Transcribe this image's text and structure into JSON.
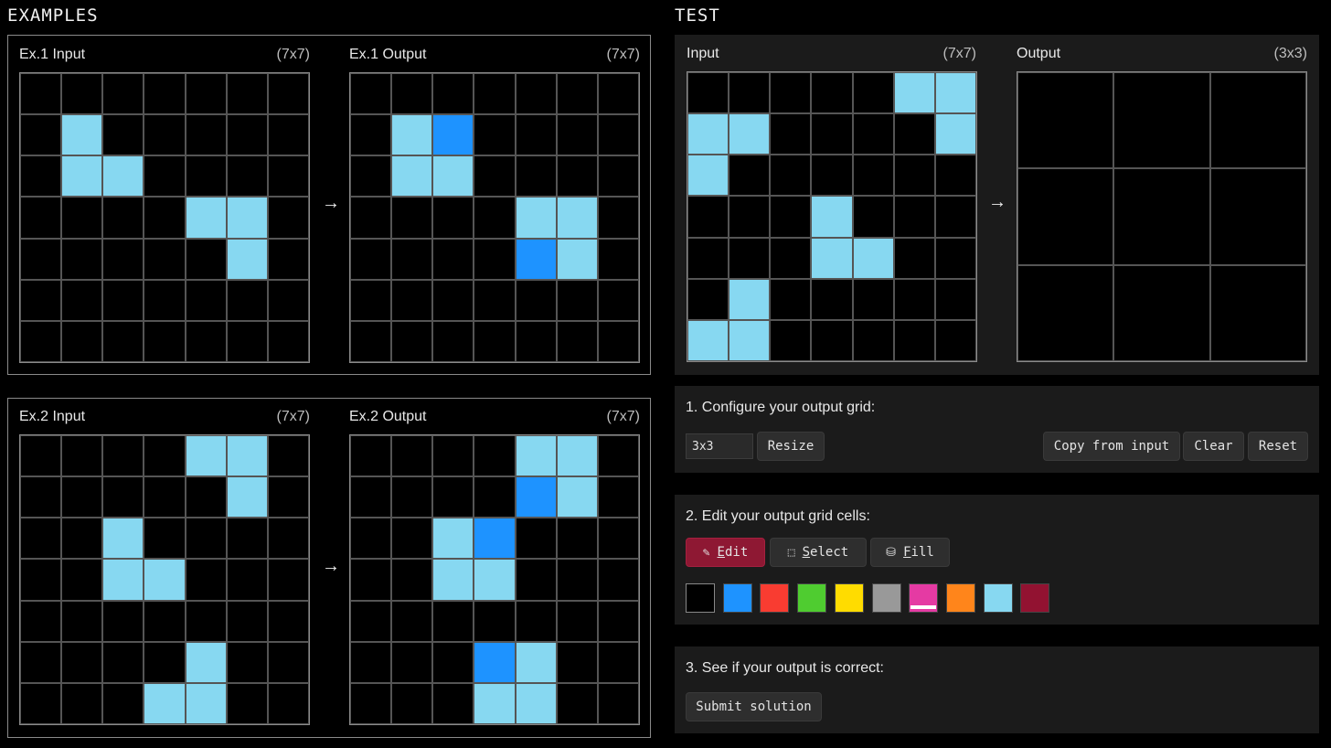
{
  "examples_title": "EXAMPLES",
  "test_title": "TEST",
  "palette": [
    "#000000",
    "#1e93ff",
    "#f93c31",
    "#4fcc30",
    "#ffdc00",
    "#999999",
    "#e53aa3",
    "#ff851b",
    "#87d8f1",
    "#921231"
  ],
  "examples": [
    {
      "input_label": "Ex.1 Input",
      "input_size": "(7x7)",
      "output_label": "Ex.1 Output",
      "output_size": "(7x7)",
      "arrow": "→",
      "input": [
        [
          0,
          0,
          0,
          0,
          0,
          0,
          0
        ],
        [
          0,
          8,
          0,
          0,
          0,
          0,
          0
        ],
        [
          0,
          8,
          8,
          0,
          0,
          0,
          0
        ],
        [
          0,
          0,
          0,
          0,
          8,
          8,
          0
        ],
        [
          0,
          0,
          0,
          0,
          0,
          8,
          0
        ],
        [
          0,
          0,
          0,
          0,
          0,
          0,
          0
        ],
        [
          0,
          0,
          0,
          0,
          0,
          0,
          0
        ]
      ],
      "output": [
        [
          0,
          0,
          0,
          0,
          0,
          0,
          0
        ],
        [
          0,
          8,
          1,
          0,
          0,
          0,
          0
        ],
        [
          0,
          8,
          8,
          0,
          0,
          0,
          0
        ],
        [
          0,
          0,
          0,
          0,
          8,
          8,
          0
        ],
        [
          0,
          0,
          0,
          0,
          1,
          8,
          0
        ],
        [
          0,
          0,
          0,
          0,
          0,
          0,
          0
        ],
        [
          0,
          0,
          0,
          0,
          0,
          0,
          0
        ]
      ]
    },
    {
      "input_label": "Ex.2 Input",
      "input_size": "(7x7)",
      "output_label": "Ex.2 Output",
      "output_size": "(7x7)",
      "arrow": "→",
      "input": [
        [
          0,
          0,
          0,
          0,
          8,
          8,
          0
        ],
        [
          0,
          0,
          0,
          0,
          0,
          8,
          0
        ],
        [
          0,
          0,
          8,
          0,
          0,
          0,
          0
        ],
        [
          0,
          0,
          8,
          8,
          0,
          0,
          0
        ],
        [
          0,
          0,
          0,
          0,
          0,
          0,
          0
        ],
        [
          0,
          0,
          0,
          0,
          8,
          0,
          0
        ],
        [
          0,
          0,
          0,
          8,
          8,
          0,
          0
        ]
      ],
      "output": [
        [
          0,
          0,
          0,
          0,
          8,
          8,
          0
        ],
        [
          0,
          0,
          0,
          0,
          1,
          8,
          0
        ],
        [
          0,
          0,
          8,
          1,
          0,
          0,
          0
        ],
        [
          0,
          0,
          8,
          8,
          0,
          0,
          0
        ],
        [
          0,
          0,
          0,
          0,
          0,
          0,
          0
        ],
        [
          0,
          0,
          0,
          1,
          8,
          0,
          0
        ],
        [
          0,
          0,
          0,
          8,
          8,
          0,
          0
        ]
      ]
    }
  ],
  "test": {
    "input_label": "Input",
    "input_size": "(7x7)",
    "output_label": "Output",
    "output_size": "(3x3)",
    "arrow": "→",
    "input": [
      [
        0,
        0,
        0,
        0,
        0,
        8,
        8
      ],
      [
        8,
        8,
        0,
        0,
        0,
        0,
        8
      ],
      [
        8,
        0,
        0,
        0,
        0,
        0,
        0
      ],
      [
        0,
        0,
        0,
        8,
        0,
        0,
        0
      ],
      [
        0,
        0,
        0,
        8,
        8,
        0,
        0
      ],
      [
        0,
        8,
        0,
        0,
        0,
        0,
        0
      ],
      [
        8,
        8,
        0,
        0,
        0,
        0,
        0
      ]
    ],
    "output": [
      [
        0,
        0,
        0
      ],
      [
        0,
        0,
        0
      ],
      [
        0,
        0,
        0
      ]
    ]
  },
  "step1": {
    "title": "1. Configure your output grid:",
    "size_value": "3x3",
    "resize_label": "Resize",
    "copy_label": "Copy from input",
    "clear_label": "Clear",
    "reset_label": "Reset"
  },
  "step2": {
    "title": "2. Edit your output grid cells:",
    "tools": [
      {
        "key": "E",
        "rest": "dit",
        "icon": "pencil-icon",
        "glyph": "✎",
        "active": true
      },
      {
        "key": "S",
        "rest": "elect",
        "icon": "select-icon",
        "glyph": "⬚",
        "active": false
      },
      {
        "key": "F",
        "rest": "ill",
        "icon": "fill-icon",
        "glyph": "⛁",
        "active": false
      }
    ],
    "selected_color_index": 6
  },
  "step3": {
    "title": "3. See if your output is correct:",
    "submit_label": "Submit solution"
  }
}
